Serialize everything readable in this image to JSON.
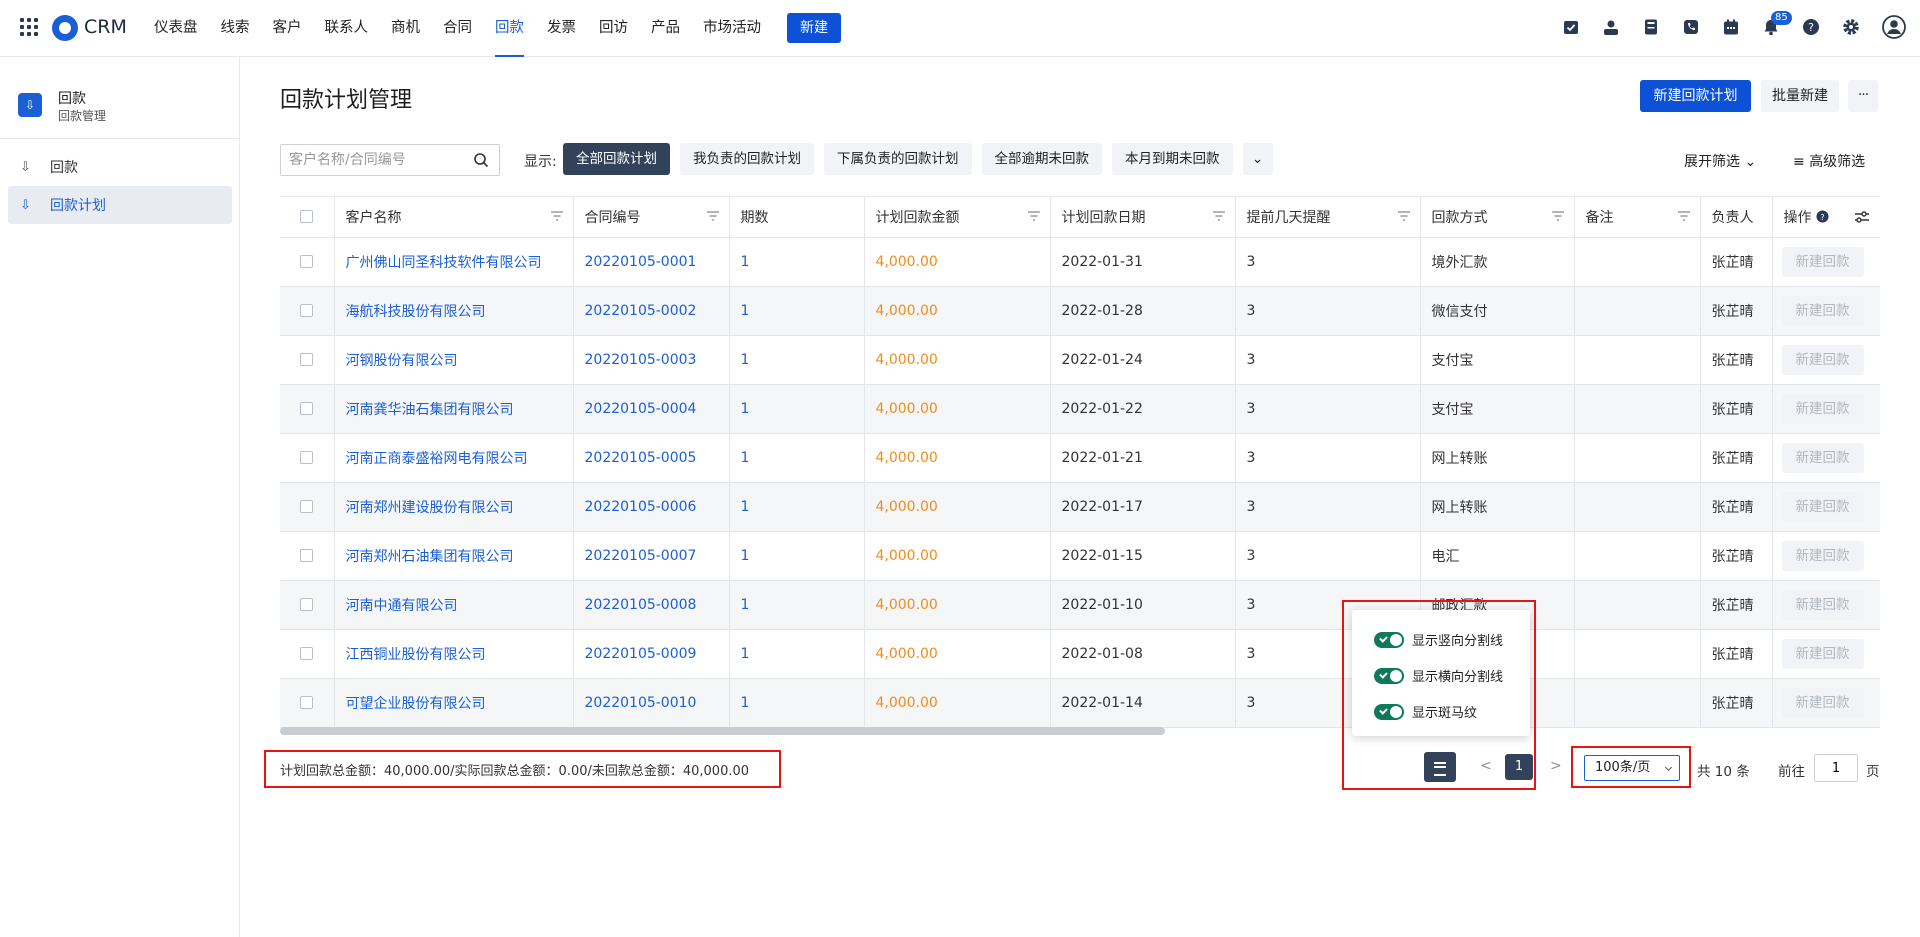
{
  "topbar": {
    "brand": "CRM",
    "nav": [
      "仪表盘",
      "线索",
      "客户",
      "联系人",
      "商机",
      "合同",
      "回款",
      "发票",
      "回访",
      "产品",
      "市场活动"
    ],
    "active_nav": "回款",
    "new_button": "新建",
    "notification_count": "85",
    "icons": [
      "task-icon",
      "contact-card-icon",
      "calculator-icon",
      "phone-icon",
      "calendar-icon",
      "bell-icon",
      "help-icon",
      "gear-icon",
      "user-avatar-icon"
    ]
  },
  "sidebar": {
    "title": "回款",
    "subtitle": "回款管理",
    "items": [
      {
        "label": "回款",
        "icon": "payment-icon"
      },
      {
        "label": "回款计划",
        "icon": "payment-plan-icon"
      }
    ]
  },
  "page": {
    "title": "回款计划管理",
    "new_plan_button": "新建回款计划",
    "batch_new_button": "批量新建",
    "more_button": "···"
  },
  "filters": {
    "search_placeholder": "客户名称/合同编号",
    "display_label": "显示:",
    "chips": [
      "全部回款计划",
      "我负责的回款计划",
      "下属负责的回款计划",
      "全部逾期未回款",
      "本月到期未回款"
    ],
    "expand_label": "展开筛选",
    "advanced_label": "高级筛选"
  },
  "table": {
    "columns": [
      "客户名称",
      "合同编号",
      "期数",
      "计划回款金额",
      "计划回款日期",
      "提前几天提醒",
      "回款方式",
      "备注",
      "负责人",
      "操作"
    ],
    "rows": [
      {
        "customer": "广州佛山同圣科技软件有限公司",
        "contract": "20220105-0001",
        "period": "1",
        "amount": "4,000.00",
        "date": "2022-01-31",
        "remind": "3",
        "method": "境外汇款",
        "note": "",
        "owner": "张芷晴"
      },
      {
        "customer": "海航科技股份有限公司",
        "contract": "20220105-0002",
        "period": "1",
        "amount": "4,000.00",
        "date": "2022-01-28",
        "remind": "3",
        "method": "微信支付",
        "note": "",
        "owner": "张芷晴"
      },
      {
        "customer": "河钢股份有限公司",
        "contract": "20220105-0003",
        "period": "1",
        "amount": "4,000.00",
        "date": "2022-01-24",
        "remind": "3",
        "method": "支付宝",
        "note": "",
        "owner": "张芷晴"
      },
      {
        "customer": "河南龚华油石集团有限公司",
        "contract": "20220105-0004",
        "period": "1",
        "amount": "4,000.00",
        "date": "2022-01-22",
        "remind": "3",
        "method": "支付宝",
        "note": "",
        "owner": "张芷晴"
      },
      {
        "customer": "河南正商泰盛裕网电有限公司",
        "contract": "20220105-0005",
        "period": "1",
        "amount": "4,000.00",
        "date": "2022-01-21",
        "remind": "3",
        "method": "网上转账",
        "note": "",
        "owner": "张芷晴"
      },
      {
        "customer": "河南郑州建设股份有限公司",
        "contract": "20220105-0006",
        "period": "1",
        "amount": "4,000.00",
        "date": "2022-01-17",
        "remind": "3",
        "method": "网上转账",
        "note": "",
        "owner": "张芷晴"
      },
      {
        "customer": "河南郑州石油集团有限公司",
        "contract": "20220105-0007",
        "period": "1",
        "amount": "4,000.00",
        "date": "2022-01-15",
        "remind": "3",
        "method": "电汇",
        "note": "",
        "owner": "张芷晴"
      },
      {
        "customer": "河南中通有限公司",
        "contract": "20220105-0008",
        "period": "1",
        "amount": "4,000.00",
        "date": "2022-01-10",
        "remind": "3",
        "method": "邮政汇款",
        "note": "",
        "owner": "张芷晴"
      },
      {
        "customer": "江西铜业股份有限公司",
        "contract": "20220105-0009",
        "period": "1",
        "amount": "4,000.00",
        "date": "2022-01-08",
        "remind": "3",
        "method": "",
        "note": "",
        "owner": "张芷晴"
      },
      {
        "customer": "可望企业股份有限公司",
        "contract": "20220105-0010",
        "period": "1",
        "amount": "4,000.00",
        "date": "2022-01-14",
        "remind": "3",
        "method": "",
        "note": "",
        "owner": "张芷晴"
      }
    ],
    "row_action": "新建回款"
  },
  "table_settings_popup": {
    "options": [
      "显示竖向分割线",
      "显示横向分割线",
      "显示斑马纹"
    ]
  },
  "footer": {
    "summary": "计划回款总金额：40,000.00/实际回款总金额：0.00/未回款总金额：40,000.00",
    "prev": "<",
    "page": "1",
    "next": ">",
    "page_size": "100条/页",
    "total": "共 10 条",
    "goto_prefix": "前往",
    "goto_value": "1",
    "goto_suffix": "页"
  },
  "colors": {
    "primary": "#0d52d6",
    "link": "#1a5fd6",
    "amount": "#f08c1c",
    "highlight_box": "#e81414",
    "toggle_on": "#0e7a5a"
  }
}
